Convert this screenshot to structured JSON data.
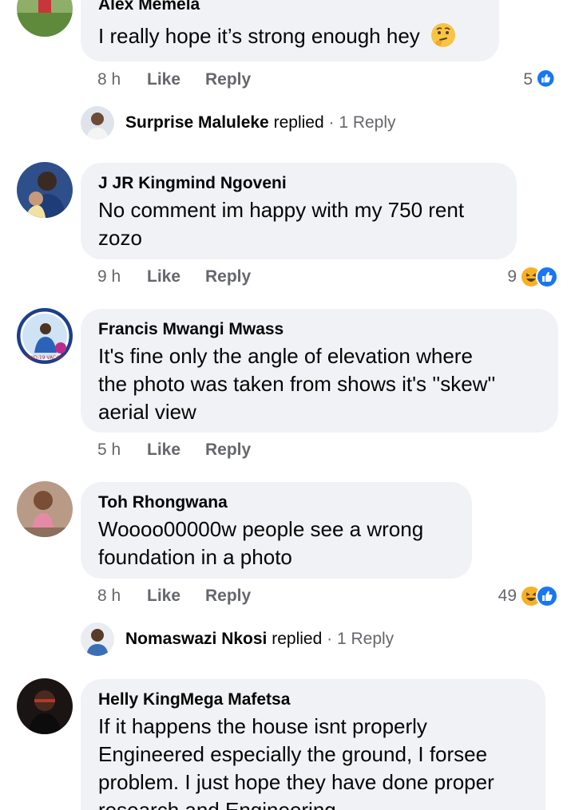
{
  "comments": [
    {
      "author": "Alex Memela",
      "lines": [
        "I really hope it’s strong enough hey"
      ],
      "emoji_icon": "thinking-face-icon",
      "time": "8 h",
      "like_label": "Like",
      "reply_label": "Reply",
      "reaction_count": "5",
      "reaction_icons": [
        "like-reaction-icon"
      ]
    },
    {
      "author": "J JR Kingmind Ngoveni",
      "lines": [
        "No comment im happy with my 750 rent",
        "zozo"
      ],
      "time": "9 h",
      "like_label": "Like",
      "reply_label": "Reply",
      "reaction_count": "9",
      "reaction_icons": [
        "haha-reaction-icon",
        "like-reaction-icon"
      ]
    },
    {
      "author": "Francis Mwangi Mwass",
      "lines": [
        "It's fine only the angle of elevation where",
        "the photo was taken from shows it's ''skew''",
        "aerial view"
      ],
      "time": "5 h",
      "like_label": "Like",
      "reply_label": "Reply",
      "badge_text": "COVID-19 VACCINE"
    },
    {
      "author": "Toh Rhongwana",
      "lines": [
        "Woooo00000w people see a wrong",
        "foundation in a photo"
      ],
      "time": "8 h",
      "like_label": "Like",
      "reply_label": "Reply",
      "reaction_count": "49",
      "reaction_icons": [
        "haha-reaction-icon",
        "like-reaction-icon"
      ]
    },
    {
      "author": "Helly KingMega Mafetsa",
      "lines": [
        "If it happens the house isnt properly",
        "Engineered especially the ground, I forsee",
        "problem. I just hope they have done proper",
        "research and Engineering."
      ]
    }
  ],
  "replies": [
    {
      "name": "Surprise Maluleke",
      "verb": "replied",
      "sep": " · ",
      "count": "1 Reply"
    },
    {
      "name": "Nomaswazi Nkosi",
      "verb": "replied",
      "sep": " · ",
      "count": "1 Reply"
    }
  ],
  "colors": {
    "bubble": "#f0f2f5",
    "secondary_text": "#65676b",
    "like_blue": "#1877f2",
    "haha_yellow": "#f7b125"
  }
}
